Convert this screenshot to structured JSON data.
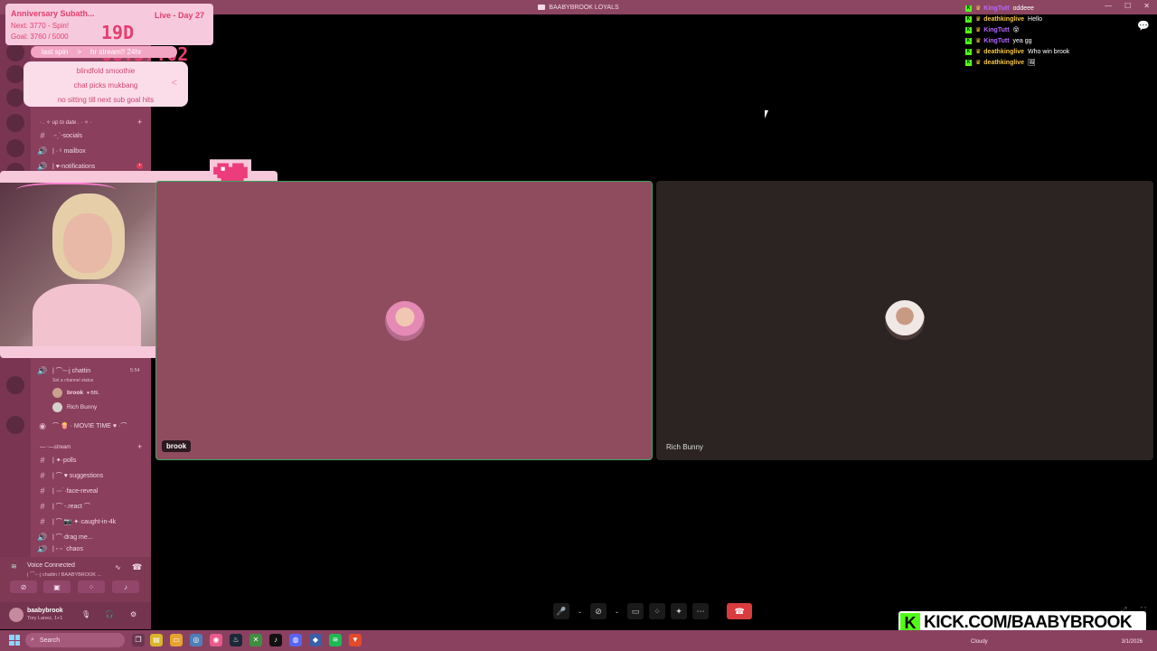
{
  "window": {
    "title": "BAABYBROOK LOYALS"
  },
  "overlay": {
    "title": "Anniversary Subath...",
    "day": "Live - Day 27",
    "next": "Next: 3770 - Spin!",
    "goal": "Goal: 3760 / 5000",
    "timer": "19D 08:57:02",
    "spin_label": "last spin",
    "spin_arrow": ">",
    "spin_result": "hr stream!! 24hr",
    "wheel_items": [
      "blindfold smoothie",
      "chat picks mukbang",
      "no sitting till next sub goal hits"
    ],
    "wheel_arrow": "<"
  },
  "sidebar": {
    "category_top": "· . ✧ up to date . · ✧ ·",
    "channels_top": [
      {
        "icon": "#",
        "label": "·-ˏˋ-socials"
      },
      {
        "icon": "🔊",
        "label": "| · ᶜ mailbox"
      },
      {
        "icon": "🔊",
        "label": "| ♥-notifications"
      }
    ],
    "voice_channel": "| ⌒-ᵕ·j chattin",
    "voice_time": "5:54",
    "voice_status": "Set a channel status",
    "members": [
      {
        "name": "brook",
        "tag": "♥ BBL"
      },
      {
        "name": "Rich Bunny",
        "tag": ""
      }
    ],
    "movie_channel": "⌒ 🍿 · MOVIE TIME ♥ ·⌒",
    "category_stream": "—·‧—stream",
    "channels_stream": [
      {
        "icon": "#",
        "label": "| ✦·polls"
      },
      {
        "icon": "#",
        "label": "| ⌒ ♥ suggestions"
      },
      {
        "icon": "#",
        "label": "| ·ᵕ·˙·face-reveal"
      },
      {
        "icon": "#",
        "label": "| ⌒˙-.react ⌒"
      },
      {
        "icon": "#",
        "label": "| ⌒ 📷 ✦·caught-in-4k"
      },
      {
        "icon": "🔊",
        "label": "| ⌒·drag me..."
      },
      {
        "icon": "🔊",
        "label": "| ᵕ ᵕ ˙chaos"
      }
    ],
    "voice_connected": "Voice Connected",
    "voice_connected_sub": "| ⌒-ᵕ·j chattin / BAABYBROOK ...",
    "user_name": "baabybrook",
    "user_sub": "Tory Lanez, 1+1"
  },
  "tiles": [
    {
      "name": "brook"
    },
    {
      "name": "Rich Bunny"
    }
  ],
  "chat": [
    {
      "user": "KingTutt",
      "color": "#b469ff",
      "msg": "oddeee"
    },
    {
      "user": "deathkinglive",
      "color": "#f5c542",
      "msg": "Hello"
    },
    {
      "user": "KingTutt",
      "color": "#b469ff",
      "msg": "😵"
    },
    {
      "user": "KingTutt",
      "color": "#b469ff",
      "msg": "yea gg"
    },
    {
      "user": "deathkinglive",
      "color": "#f5c542",
      "msg": "Who win brook"
    },
    {
      "user": "deathkinglive",
      "color": "#f5c542",
      "msg": "🖼"
    }
  ],
  "kick": {
    "logo": "K",
    "text": "KICK.COM/BAABYBROOK"
  },
  "taskbar": {
    "search_placeholder": "Search",
    "weather": "Cloudy",
    "date": "3/1/2026"
  },
  "colors": {
    "sidebar": "#8a3f5c",
    "tile_brook": "#8f4c5f",
    "tile_rich": "#2b2423",
    "speaking_border": "#3ba55d",
    "hangup": "#d83c3e",
    "kick_green": "#53fc18"
  }
}
